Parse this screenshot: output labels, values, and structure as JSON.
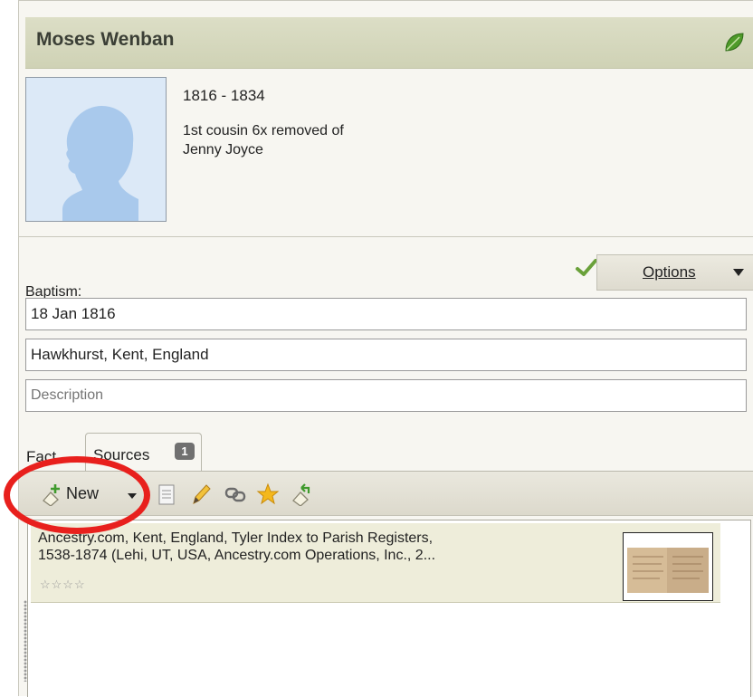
{
  "person": {
    "name": "Moses Wenban",
    "lifespan": "1816 - 1834",
    "relationship_line1": "1st cousin 6x removed of",
    "relationship_line2": "Jenny Joyce"
  },
  "fact": {
    "label": "Baptism:",
    "options_label": "Options",
    "date": "18 Jan 1816",
    "place": "Hawkhurst, Kent, England",
    "description_placeholder": "Description"
  },
  "tabs": {
    "fact_label": "Fact",
    "sources_label": "Sources",
    "sources_count": "1"
  },
  "toolbar": {
    "new_label": "New"
  },
  "sources": [
    {
      "line1": "Ancestry.com, Kent, England, Tyler Index to Parish Registers,",
      "line2": "1538-1874 (Lehi, UT, USA, Ancestry.com Operations, Inc., 2...",
      "stars": "☆☆☆☆"
    }
  ],
  "colors": {
    "header_bg": "#d5d8bc",
    "leaf_green": "#4f9a2a",
    "check_green": "#6aa13a",
    "highlight_circle": "#e8201d",
    "silhouette": "#a9c9ec"
  },
  "icons": [
    "leaf-icon",
    "avatar-silhouette",
    "checkmark-icon",
    "new-source-icon",
    "document-icon",
    "edit-pencil-icon",
    "link-icon",
    "star-icon",
    "back-arrow-icon"
  ]
}
